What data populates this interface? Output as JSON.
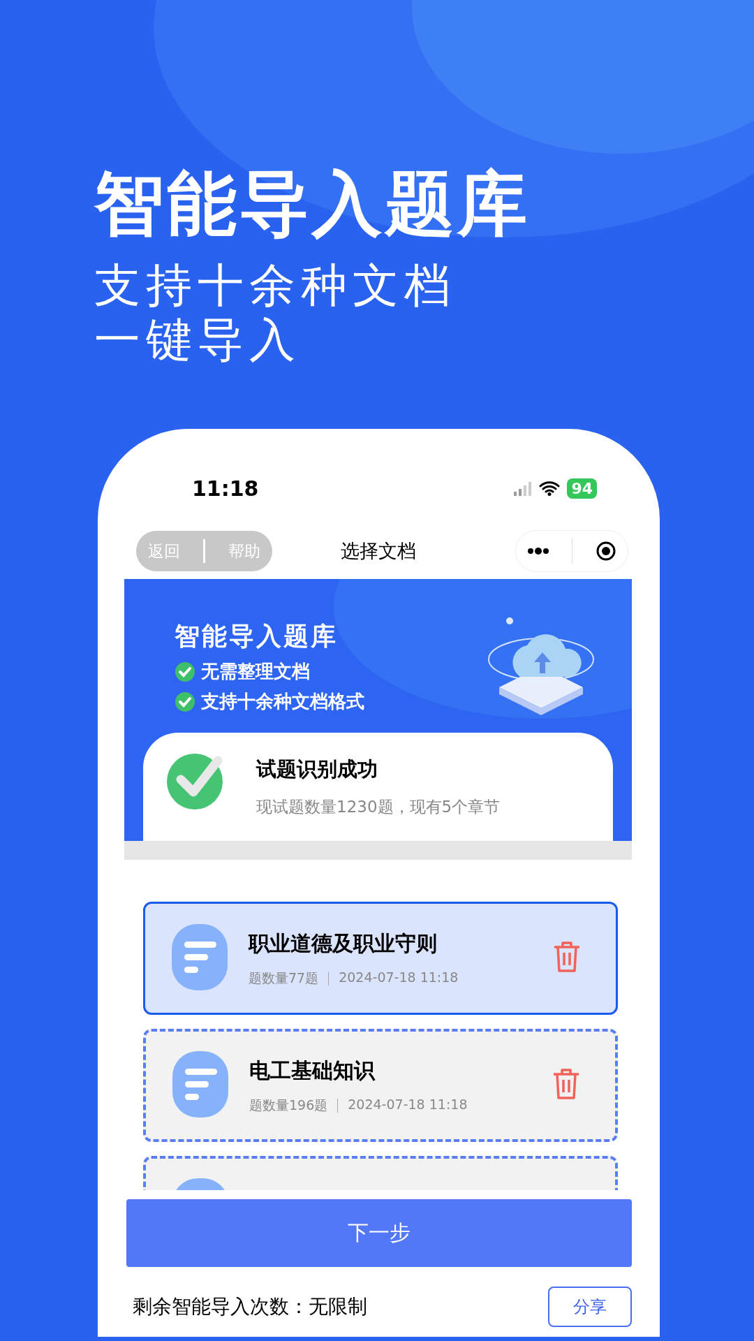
{
  "hero": {
    "title": "智能导入题库",
    "subtitle_lines": [
      "支持十余种文档",
      "一键导入"
    ]
  },
  "status_bar": {
    "time": "11:18",
    "battery": "94"
  },
  "nav_bar": {
    "buttons": [
      "返回",
      "帮助"
    ],
    "title": "选择文档"
  },
  "banner": {
    "title": "智能导入题库",
    "features": [
      "无需整理文档",
      "支持十余种文档格式"
    ]
  },
  "result_card": {
    "title": "试题识别成功",
    "detail": "现试题数量1230题，现有5个章节"
  },
  "documents": [
    {
      "title": "职业道德及职业守则",
      "count": "题数量77题",
      "date": "2024-07-18 11:18",
      "selected": true
    },
    {
      "title": "电工基础知识",
      "count": "题数量196题",
      "date": "2024-07-18 11:18",
      "selected": false
    },
    {
      "selected": false
    }
  ],
  "next_button": "下一步",
  "footer": {
    "remaining": "剩余智能导入次数：无限制",
    "share_button": "分享"
  }
}
